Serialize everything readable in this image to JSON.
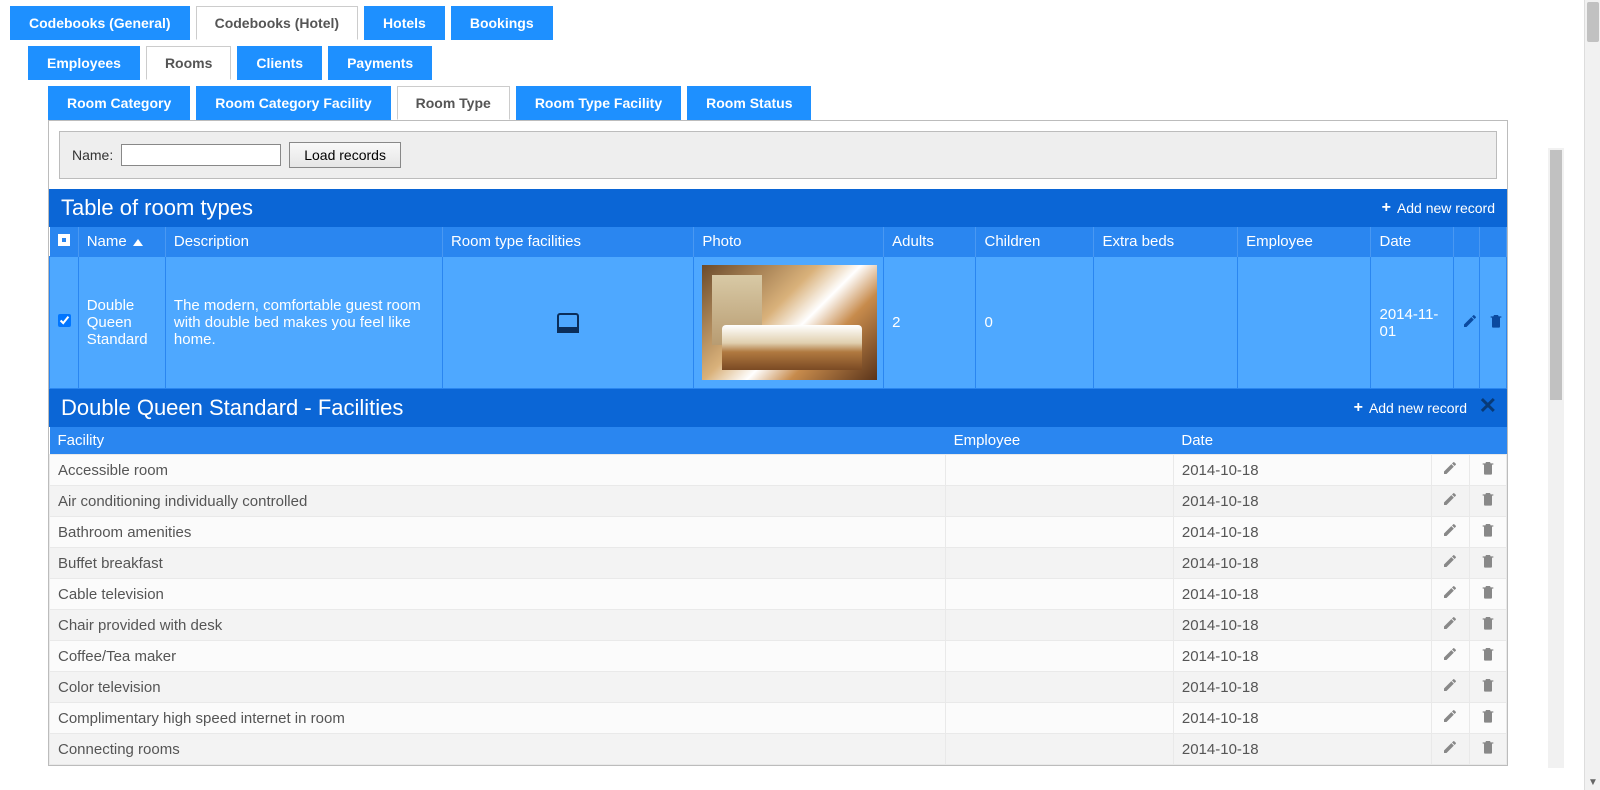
{
  "tabs_level1": [
    {
      "label": "Codebooks (General)",
      "active": false
    },
    {
      "label": "Codebooks (Hotel)",
      "active": true
    },
    {
      "label": "Hotels",
      "active": false
    },
    {
      "label": "Bookings",
      "active": false
    }
  ],
  "tabs_level2": [
    {
      "label": "Employees",
      "active": false
    },
    {
      "label": "Rooms",
      "active": true
    },
    {
      "label": "Clients",
      "active": false
    },
    {
      "label": "Payments",
      "active": false
    }
  ],
  "tabs_level3": [
    {
      "label": "Room Category",
      "active": false
    },
    {
      "label": "Room Category Facility",
      "active": false
    },
    {
      "label": "Room Type",
      "active": true
    },
    {
      "label": "Room Type Facility",
      "active": false
    },
    {
      "label": "Room Status",
      "active": false
    }
  ],
  "filter": {
    "name_label": "Name:",
    "name_value": "",
    "load_button": "Load records"
  },
  "room_types_table": {
    "title": "Table of room types",
    "add_label": "Add new record",
    "columns": [
      "",
      "Name",
      "Description",
      "Room type facilities",
      "Photo",
      "Adults",
      "Children",
      "Extra beds",
      "Employee",
      "Date"
    ],
    "rows": [
      {
        "checked": true,
        "name": "Double Queen Standard",
        "description": "The modern, comfortable guest room with double bed makes you feel like home.",
        "facilities_icon": "bed-icon",
        "photo": "hotel-room-photo",
        "adults": "2",
        "children": "0",
        "extra_beds": "",
        "employee": "",
        "date": "2014-11-01"
      }
    ]
  },
  "facilities_panel": {
    "title": "Double Queen Standard - Facilities",
    "add_label": "Add new record",
    "columns": [
      "Facility",
      "Employee",
      "Date"
    ],
    "rows": [
      {
        "facility": "Accessible room",
        "employee": "",
        "date": "2014-10-18"
      },
      {
        "facility": "Air conditioning individually controlled",
        "employee": "",
        "date": "2014-10-18"
      },
      {
        "facility": "Bathroom amenities",
        "employee": "",
        "date": "2014-10-18"
      },
      {
        "facility": "Buffet breakfast",
        "employee": "",
        "date": "2014-10-18"
      },
      {
        "facility": "Cable television",
        "employee": "",
        "date": "2014-10-18"
      },
      {
        "facility": "Chair provided with desk",
        "employee": "",
        "date": "2014-10-18"
      },
      {
        "facility": "Coffee/Tea maker",
        "employee": "",
        "date": "2014-10-18"
      },
      {
        "facility": "Color television",
        "employee": "",
        "date": "2014-10-18"
      },
      {
        "facility": "Complimentary high speed internet in room",
        "employee": "",
        "date": "2014-10-18"
      },
      {
        "facility": "Connecting rooms",
        "employee": "",
        "date": "2014-10-18"
      }
    ]
  }
}
